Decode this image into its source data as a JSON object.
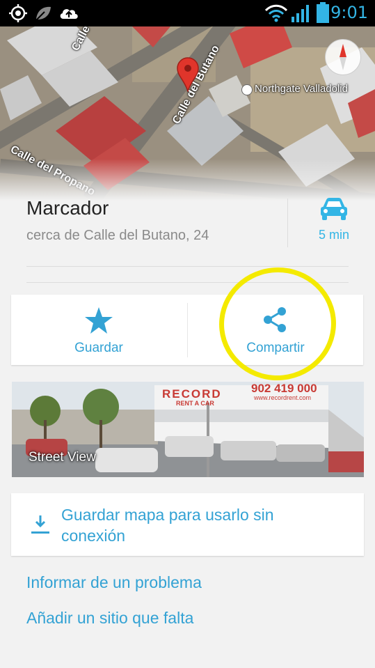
{
  "status_bar": {
    "time": "9:01",
    "icons": [
      "gps-icon",
      "leaf-icon",
      "cloud-upload-icon",
      "wifi-icon",
      "signal-icon",
      "battery-icon"
    ],
    "accent": "#33b5e5"
  },
  "map": {
    "street_labels": [
      "Calle del",
      "Calle del Butano",
      "Calle del Propano"
    ],
    "poi_label": "Northgate Valladolid"
  },
  "place": {
    "title": "Marcador",
    "subtitle": "cerca de Calle del Butano, 24",
    "drive_time": "5 min"
  },
  "actions": {
    "save_label": "Guardar",
    "share_label": "Compartir"
  },
  "street_view": {
    "label": "Street View",
    "sign_brand": "RECORD",
    "sign_sub": "RENT A CAR",
    "sign_phone": "902 419 000",
    "sign_web": "www.recordrent.com"
  },
  "offline": {
    "label": "Guardar mapa para usarlo sin conexión"
  },
  "links": {
    "report_problem": "Informar de un problema",
    "add_place": "Añadir un sitio que falta"
  },
  "colors": {
    "link_blue": "#33a2d4",
    "highlight_yellow": "#f4ea00",
    "pin_red": "#e0352b"
  }
}
